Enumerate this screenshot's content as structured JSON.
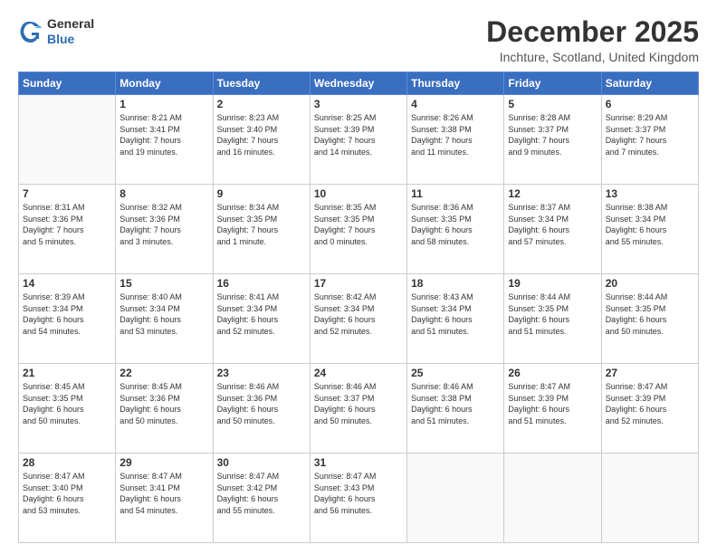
{
  "header": {
    "logo_general": "General",
    "logo_blue": "Blue",
    "month_title": "December 2025",
    "location": "Inchture, Scotland, United Kingdom"
  },
  "days_of_week": [
    "Sunday",
    "Monday",
    "Tuesday",
    "Wednesday",
    "Thursday",
    "Friday",
    "Saturday"
  ],
  "weeks": [
    [
      {
        "day": "",
        "info": ""
      },
      {
        "day": "1",
        "info": "Sunrise: 8:21 AM\nSunset: 3:41 PM\nDaylight: 7 hours\nand 19 minutes."
      },
      {
        "day": "2",
        "info": "Sunrise: 8:23 AM\nSunset: 3:40 PM\nDaylight: 7 hours\nand 16 minutes."
      },
      {
        "day": "3",
        "info": "Sunrise: 8:25 AM\nSunset: 3:39 PM\nDaylight: 7 hours\nand 14 minutes."
      },
      {
        "day": "4",
        "info": "Sunrise: 8:26 AM\nSunset: 3:38 PM\nDaylight: 7 hours\nand 11 minutes."
      },
      {
        "day": "5",
        "info": "Sunrise: 8:28 AM\nSunset: 3:37 PM\nDaylight: 7 hours\nand 9 minutes."
      },
      {
        "day": "6",
        "info": "Sunrise: 8:29 AM\nSunset: 3:37 PM\nDaylight: 7 hours\nand 7 minutes."
      }
    ],
    [
      {
        "day": "7",
        "info": "Sunrise: 8:31 AM\nSunset: 3:36 PM\nDaylight: 7 hours\nand 5 minutes."
      },
      {
        "day": "8",
        "info": "Sunrise: 8:32 AM\nSunset: 3:36 PM\nDaylight: 7 hours\nand 3 minutes."
      },
      {
        "day": "9",
        "info": "Sunrise: 8:34 AM\nSunset: 3:35 PM\nDaylight: 7 hours\nand 1 minute."
      },
      {
        "day": "10",
        "info": "Sunrise: 8:35 AM\nSunset: 3:35 PM\nDaylight: 7 hours\nand 0 minutes."
      },
      {
        "day": "11",
        "info": "Sunrise: 8:36 AM\nSunset: 3:35 PM\nDaylight: 6 hours\nand 58 minutes."
      },
      {
        "day": "12",
        "info": "Sunrise: 8:37 AM\nSunset: 3:34 PM\nDaylight: 6 hours\nand 57 minutes."
      },
      {
        "day": "13",
        "info": "Sunrise: 8:38 AM\nSunset: 3:34 PM\nDaylight: 6 hours\nand 55 minutes."
      }
    ],
    [
      {
        "day": "14",
        "info": "Sunrise: 8:39 AM\nSunset: 3:34 PM\nDaylight: 6 hours\nand 54 minutes."
      },
      {
        "day": "15",
        "info": "Sunrise: 8:40 AM\nSunset: 3:34 PM\nDaylight: 6 hours\nand 53 minutes."
      },
      {
        "day": "16",
        "info": "Sunrise: 8:41 AM\nSunset: 3:34 PM\nDaylight: 6 hours\nand 52 minutes."
      },
      {
        "day": "17",
        "info": "Sunrise: 8:42 AM\nSunset: 3:34 PM\nDaylight: 6 hours\nand 52 minutes."
      },
      {
        "day": "18",
        "info": "Sunrise: 8:43 AM\nSunset: 3:34 PM\nDaylight: 6 hours\nand 51 minutes."
      },
      {
        "day": "19",
        "info": "Sunrise: 8:44 AM\nSunset: 3:35 PM\nDaylight: 6 hours\nand 51 minutes."
      },
      {
        "day": "20",
        "info": "Sunrise: 8:44 AM\nSunset: 3:35 PM\nDaylight: 6 hours\nand 50 minutes."
      }
    ],
    [
      {
        "day": "21",
        "info": "Sunrise: 8:45 AM\nSunset: 3:35 PM\nDaylight: 6 hours\nand 50 minutes."
      },
      {
        "day": "22",
        "info": "Sunrise: 8:45 AM\nSunset: 3:36 PM\nDaylight: 6 hours\nand 50 minutes."
      },
      {
        "day": "23",
        "info": "Sunrise: 8:46 AM\nSunset: 3:36 PM\nDaylight: 6 hours\nand 50 minutes."
      },
      {
        "day": "24",
        "info": "Sunrise: 8:46 AM\nSunset: 3:37 PM\nDaylight: 6 hours\nand 50 minutes."
      },
      {
        "day": "25",
        "info": "Sunrise: 8:46 AM\nSunset: 3:38 PM\nDaylight: 6 hours\nand 51 minutes."
      },
      {
        "day": "26",
        "info": "Sunrise: 8:47 AM\nSunset: 3:39 PM\nDaylight: 6 hours\nand 51 minutes."
      },
      {
        "day": "27",
        "info": "Sunrise: 8:47 AM\nSunset: 3:39 PM\nDaylight: 6 hours\nand 52 minutes."
      }
    ],
    [
      {
        "day": "28",
        "info": "Sunrise: 8:47 AM\nSunset: 3:40 PM\nDaylight: 6 hours\nand 53 minutes."
      },
      {
        "day": "29",
        "info": "Sunrise: 8:47 AM\nSunset: 3:41 PM\nDaylight: 6 hours\nand 54 minutes."
      },
      {
        "day": "30",
        "info": "Sunrise: 8:47 AM\nSunset: 3:42 PM\nDaylight: 6 hours\nand 55 minutes."
      },
      {
        "day": "31",
        "info": "Sunrise: 8:47 AM\nSunset: 3:43 PM\nDaylight: 6 hours\nand 56 minutes."
      },
      {
        "day": "",
        "info": ""
      },
      {
        "day": "",
        "info": ""
      },
      {
        "day": "",
        "info": ""
      }
    ]
  ]
}
